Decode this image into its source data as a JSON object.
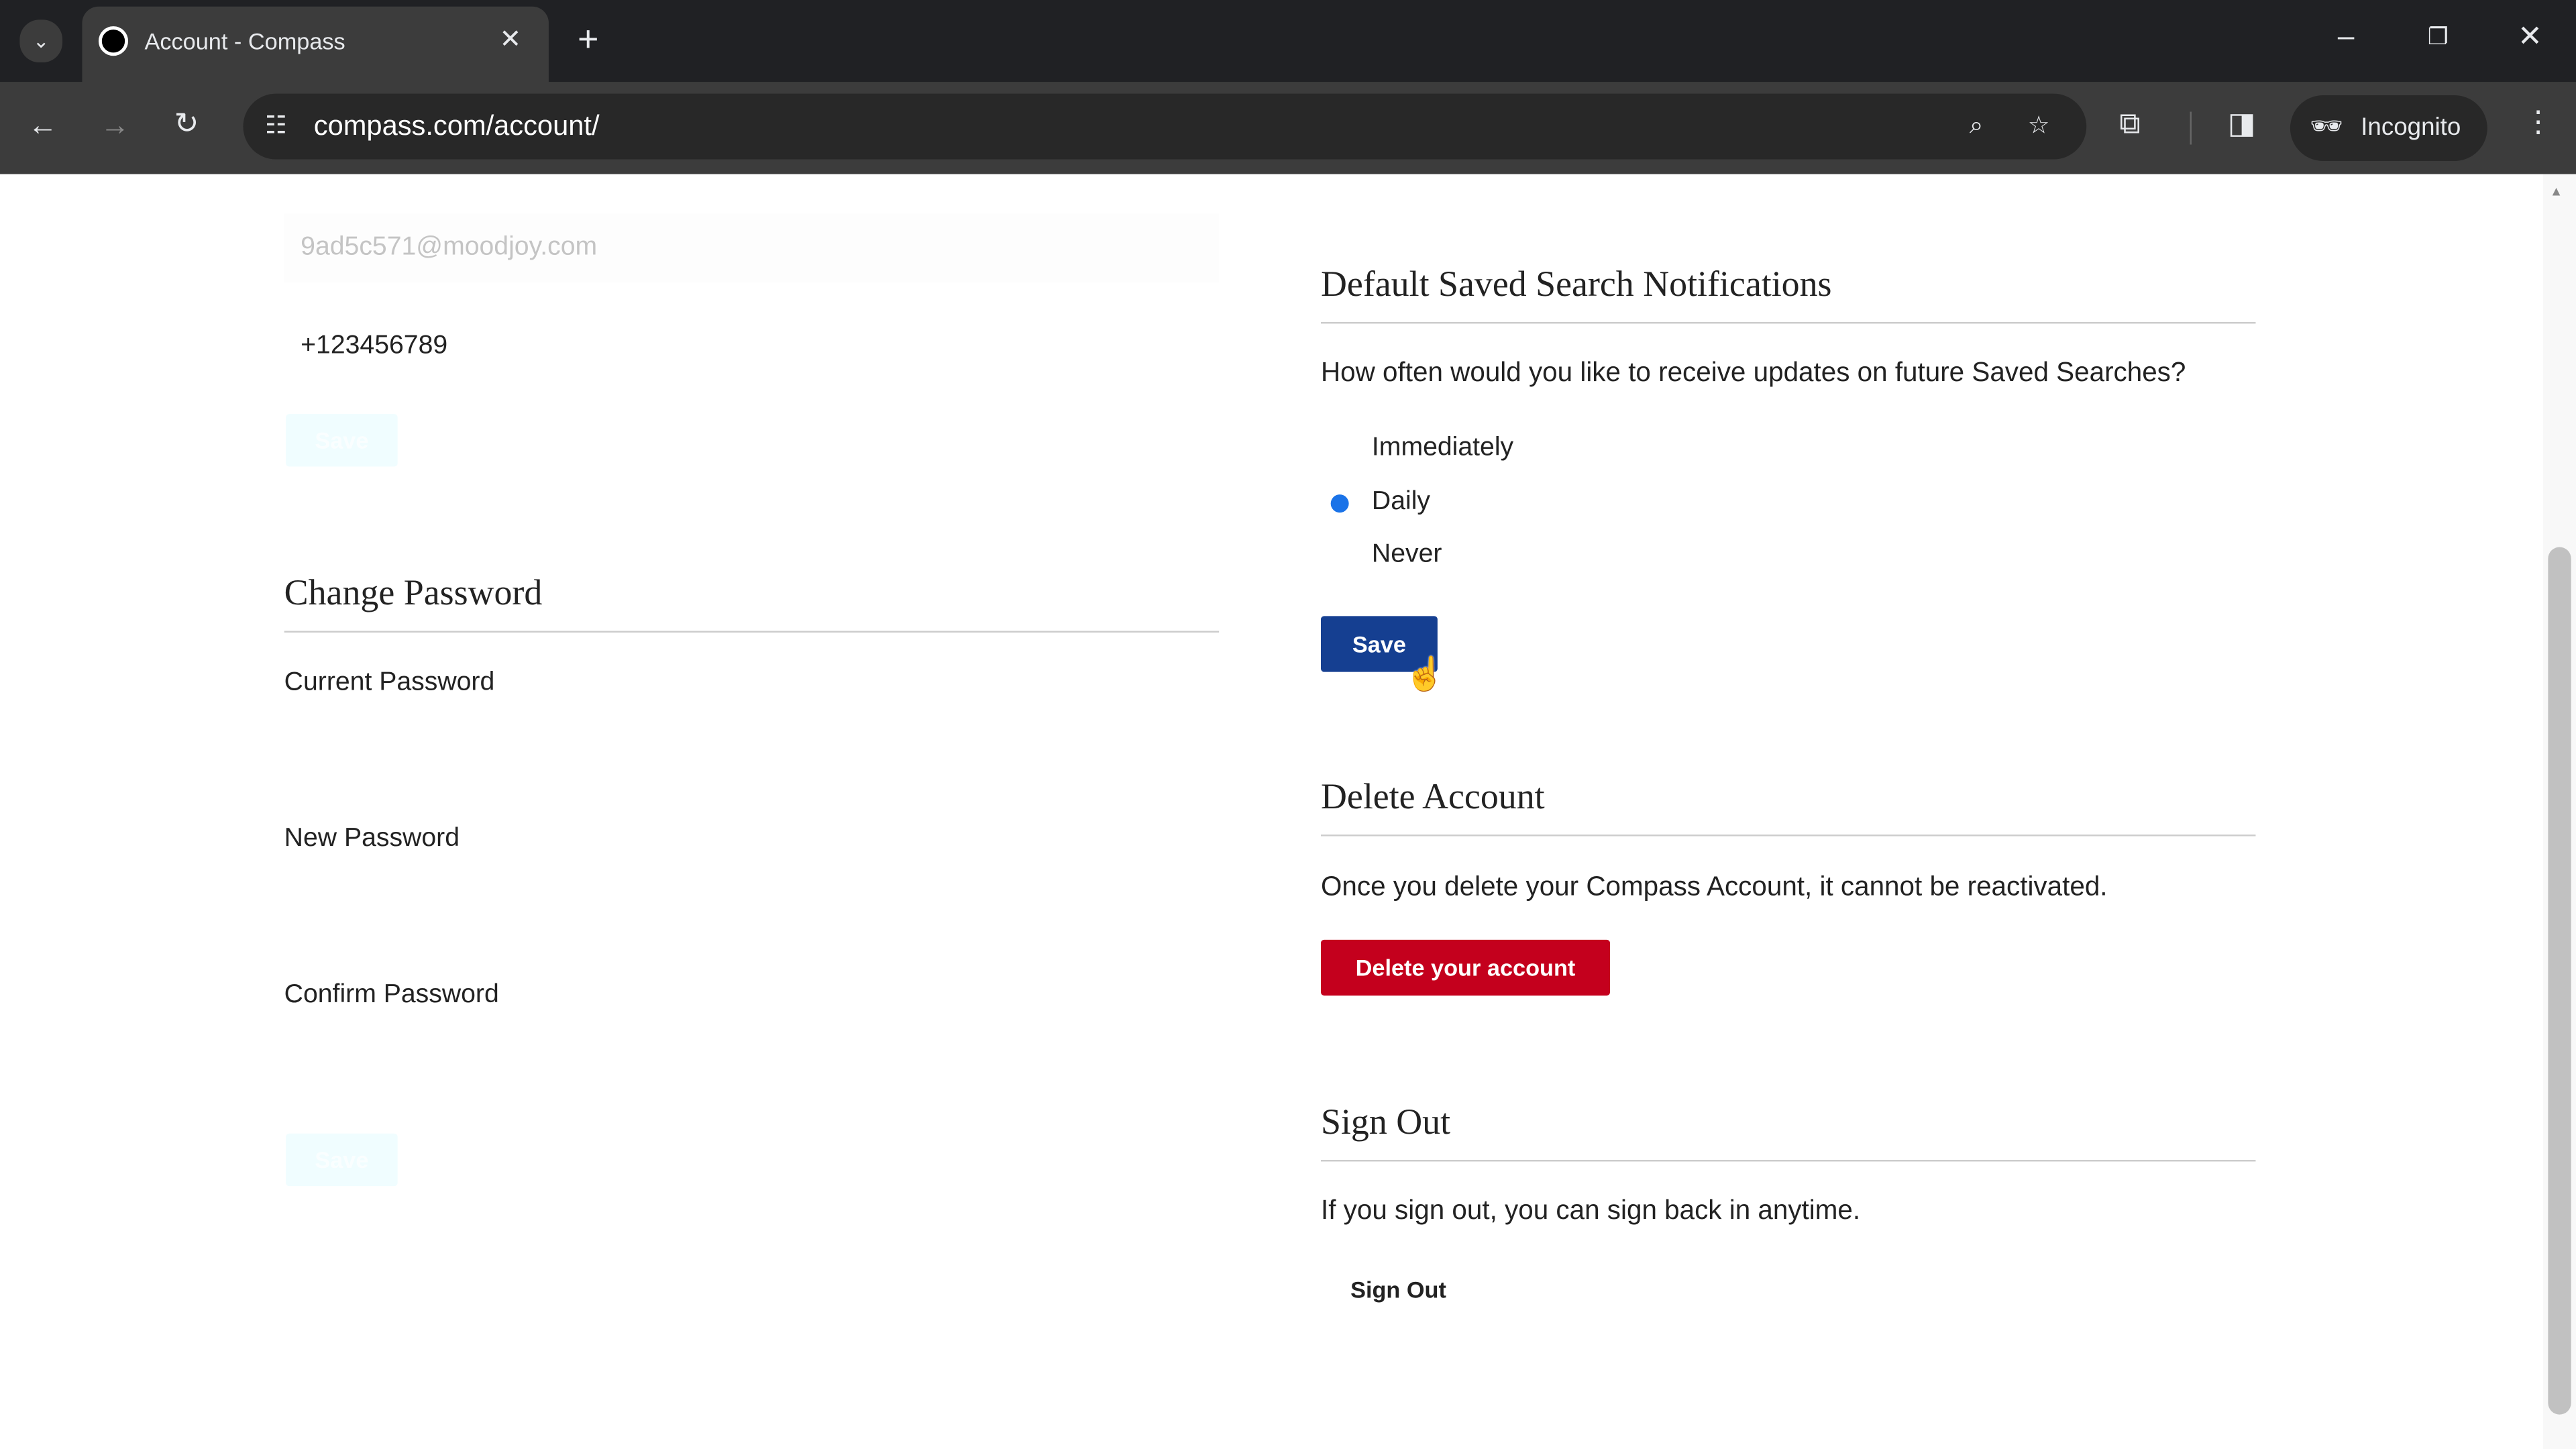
{
  "browser": {
    "tab_title": "Account - Compass",
    "url": "compass.com/account/",
    "profile_label": "Incognito"
  },
  "left": {
    "email_value": "9ad5c571@moodjoy.com",
    "phone_value": "+123456789",
    "contact_save_label": "Save",
    "change_password_heading": "Change Password",
    "current_password_label": "Current Password",
    "new_password_label": "New Password",
    "confirm_password_label": "Confirm Password",
    "password_save_label": "Save"
  },
  "notifications": {
    "heading": "Default Saved Search Notifications",
    "question": "How often would you like to receive updates on future Saved Searches?",
    "options": [
      {
        "label": "Immediately",
        "selected": false
      },
      {
        "label": "Daily",
        "selected": true
      },
      {
        "label": "Never",
        "selected": false
      }
    ],
    "save_label": "Save"
  },
  "delete_account": {
    "heading": "Delete Account",
    "text": "Once you delete your Compass Account, it cannot be reactivated.",
    "button_label": "Delete your account"
  },
  "sign_out": {
    "heading": "Sign Out",
    "text": "If you sign out, you can sign back in anytime.",
    "link_label": "Sign Out"
  },
  "colors": {
    "primary": "#153f91",
    "danger": "#c4001d",
    "radio": "#1a73e8"
  }
}
